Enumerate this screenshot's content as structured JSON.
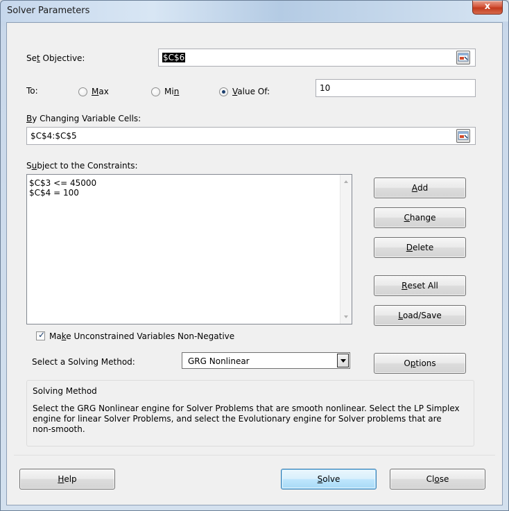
{
  "window": {
    "title": "Solver Parameters",
    "close_glyph": "x"
  },
  "objective": {
    "label_pre": "Se",
    "label_accel": "t",
    "label_post": " Objective:",
    "value": "$C$6",
    "ref_icon": "cell-reference-icon"
  },
  "to": {
    "label": "To:",
    "options": [
      {
        "accel": "M",
        "rest": "ax",
        "pre": "",
        "checked": false
      },
      {
        "pre": "Mi",
        "accel": "n",
        "rest": "",
        "checked": false
      },
      {
        "pre": "",
        "accel": "V",
        "rest": "alue Of:",
        "checked": true
      }
    ],
    "value_of": "10"
  },
  "changing": {
    "label_accel": "B",
    "label_rest": "y Changing Variable Cells:",
    "value": "$C$4:$C$5"
  },
  "constraints": {
    "label_pre": "S",
    "label_accel": "u",
    "label_rest": "bject to the Constraints:",
    "items": [
      "$C$3 <= 45000",
      "$C$4 = 100"
    ]
  },
  "buttons": {
    "add": {
      "accel": "A",
      "rest": "dd"
    },
    "change": {
      "accel": "C",
      "rest": "hange"
    },
    "delete": {
      "accel": "D",
      "rest": "elete"
    },
    "reset_all": {
      "accel": "R",
      "rest": "eset All"
    },
    "load_save": {
      "accel": "L",
      "rest": "oad/Save"
    },
    "options": {
      "pre": "O",
      "accel": "p",
      "rest": "tions"
    },
    "help": {
      "accel": "H",
      "rest": "elp"
    },
    "solve": {
      "accel": "S",
      "rest": "olve"
    },
    "close": {
      "pre": "Cl",
      "accel": "o",
      "rest": "se"
    }
  },
  "nonneg": {
    "checked": true,
    "label_pre": "Ma",
    "label_accel": "k",
    "label_rest": "e Unconstrained Variables Non-Negative"
  },
  "method": {
    "label": "Select a Solving Method:",
    "selected": "GRG Nonlinear"
  },
  "solving_method": {
    "heading": "Solving Method",
    "lines": [
      "Select the GRG Nonlinear engine for Solver Problems that are smooth nonlinear. Select the LP Simplex",
      "engine for linear Solver Problems, and select the Evolutionary engine for Solver problems that are",
      "non-smooth."
    ]
  },
  "colors": {
    "default_button_border": "#3c7fb1",
    "close_button": "#c23a1d",
    "dialog_bg": "#f0f0f0"
  }
}
